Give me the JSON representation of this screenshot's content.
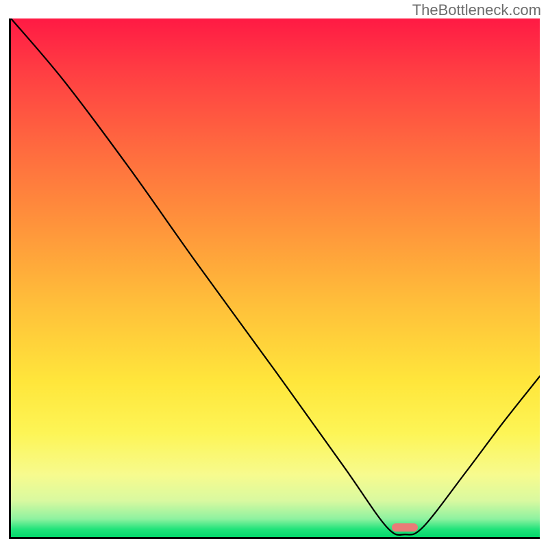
{
  "watermark": "TheBottleneck.com",
  "chart_data": {
    "type": "line",
    "title": "",
    "xlabel": "",
    "ylabel": "",
    "xlim": [
      0,
      100
    ],
    "ylim": [
      0,
      100
    ],
    "grid": false,
    "legend": false,
    "background": "red-to-green vertical gradient",
    "description": "Curve starts at top-left, descends (initially slightly convex, then roughly linear) to a flat minimum at the bottom around x≈71–78, then rises roughly linearly to the right edge.",
    "series": [
      {
        "name": "curve",
        "x": [
          0,
          10,
          22.5,
          35,
          50,
          63,
          71,
          74.5,
          78,
          86,
          93,
          100
        ],
        "values": [
          100,
          88,
          71,
          53,
          32,
          13.5,
          2,
          0.5,
          2,
          12.5,
          22,
          31
        ]
      }
    ],
    "marker": {
      "x_center": 74.5,
      "y": 1,
      "width_pct": 5,
      "color": "#e97b77",
      "shape": "rounded-rect"
    }
  }
}
